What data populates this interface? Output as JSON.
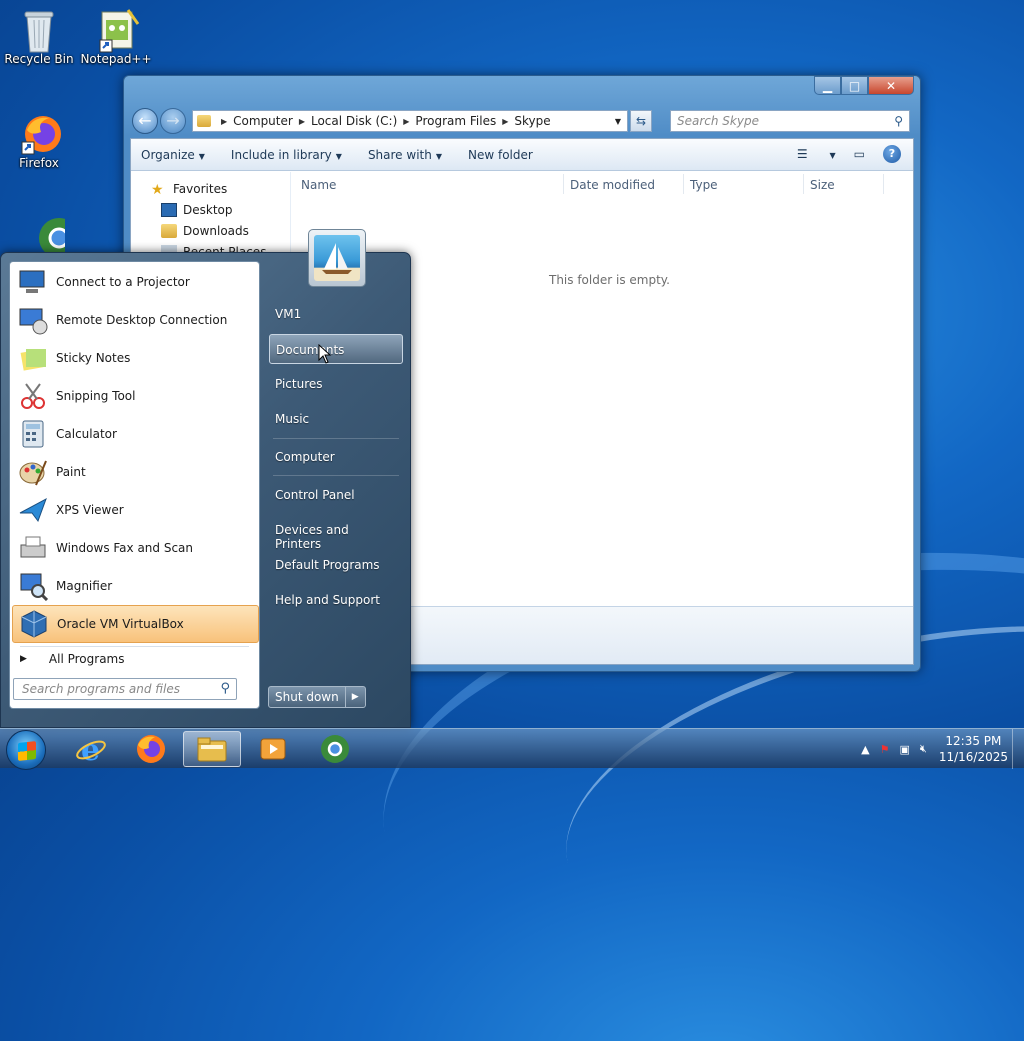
{
  "desktop": {
    "icons": [
      {
        "label": "Recycle Bin"
      },
      {
        "label": "Notepad++"
      },
      {
        "label": "Firefox"
      }
    ]
  },
  "explorer": {
    "breadcrumbs": [
      "Computer",
      "Local Disk (C:)",
      "Program Files",
      "Skype"
    ],
    "search_placeholder": "Search Skype",
    "toolbar": {
      "organize": "Organize",
      "include_in_library": "Include in library",
      "share_with": "Share with",
      "new_folder": "New folder"
    },
    "nav_pane": {
      "favorites": "Favorites",
      "items": [
        "Desktop",
        "Downloads",
        "Recent Places"
      ]
    },
    "columns": [
      "Name",
      "Date modified",
      "Type",
      "Size"
    ],
    "empty_message": "This folder is empty."
  },
  "start_menu": {
    "programs": [
      {
        "label": "Connect to a Projector",
        "icon": "projector-icon"
      },
      {
        "label": "Remote Desktop Connection",
        "icon": "remote-desktop-icon"
      },
      {
        "label": "Sticky Notes",
        "icon": "sticky-notes-icon"
      },
      {
        "label": "Snipping Tool",
        "icon": "scissors-icon"
      },
      {
        "label": "Calculator",
        "icon": "calculator-icon"
      },
      {
        "label": "Paint",
        "icon": "palette-icon"
      },
      {
        "label": "XPS Viewer",
        "icon": "xps-viewer-icon"
      },
      {
        "label": "Windows Fax and Scan",
        "icon": "fax-icon"
      },
      {
        "label": "Magnifier",
        "icon": "magnifier-icon"
      },
      {
        "label": "Oracle VM VirtualBox",
        "icon": "virtualbox-icon"
      }
    ],
    "all_programs": "All Programs",
    "search_placeholder": "Search programs and files",
    "user": "VM1",
    "right_items": [
      "Documents",
      "Pictures",
      "Music",
      "Computer",
      "Control Panel",
      "Devices and Printers",
      "Default Programs",
      "Help and Support"
    ],
    "shutdown": "Shut down"
  },
  "taskbar": {
    "time": "12:35 PM",
    "date": "11/16/2025"
  }
}
